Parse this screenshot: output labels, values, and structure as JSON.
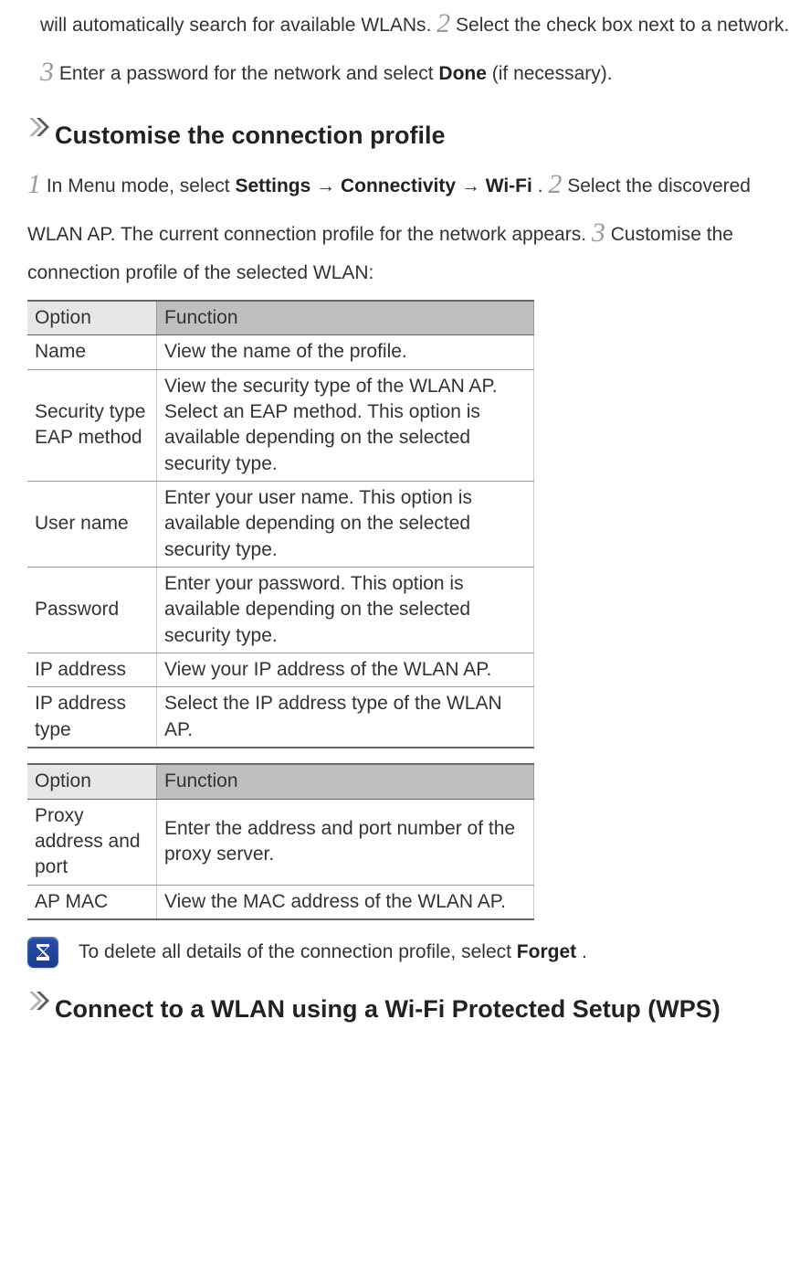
{
  "intro": {
    "pre2": "will automatically search for available WLANs. ",
    "n2": "2",
    "post2": " Select the check box next to a network. ",
    "n3": "3",
    "post3a": " Enter a password for the network and select ",
    "done": "Done",
    "post3b": " (if necessary)."
  },
  "section_customise": {
    "title": "Customise the connection profile",
    "n1": "1",
    "s1a": " In Menu mode, select ",
    "settings": "Settings",
    "arrow": " →",
    "connectivity": "Connectivity",
    "wifi": "Wi-Fi",
    "s1b": ". ",
    "n2": "2",
    "s2": " Select the discovered WLAN AP. The current connection profile for the network appears. ",
    "n3": "3",
    "s3": " Customise the connection profile of the selected WLAN:"
  },
  "table1": {
    "h1": "Option",
    "h2": "Function",
    "rows": [
      {
        "opt": "Name",
        "fn": "View the name of the profile."
      },
      {
        "opt": "Security type EAP method",
        "fn": "View the security type of the WLAN AP. Select an EAP method. This option is available depending on the selected security type."
      },
      {
        "opt": "User name",
        "fn": "Enter your user name. This option is available depending on the selected security type."
      },
      {
        "opt": "Password",
        "fn": "Enter your password. This option is available depending on the selected security type."
      },
      {
        "opt": "IP address",
        "fn": "View your IP address of the WLAN AP."
      },
      {
        "opt": "IP address type",
        "fn": "Select the IP address type of the WLAN AP."
      }
    ]
  },
  "table2": {
    "h1": "Option",
    "h2": "Function",
    "rows": [
      {
        "opt": "Proxy address and port",
        "fn": "Enter the address and port number of the proxy server."
      },
      {
        "opt": "AP MAC",
        "fn": "View the MAC address of the WLAN AP."
      }
    ]
  },
  "note": {
    "text_a": "To delete all details of the connection profile, select ",
    "forget": "Forget",
    "text_b": "."
  },
  "section_wps": {
    "title": "Connect to a WLAN using a Wi-Fi Protected Setup (WPS)"
  }
}
